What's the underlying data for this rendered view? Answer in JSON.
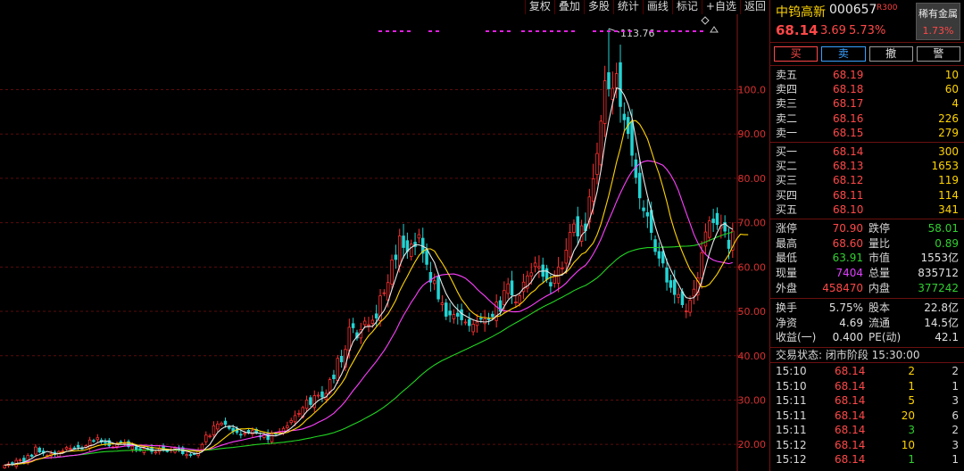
{
  "toolbar": [
    "复权",
    "叠加",
    "多股",
    "统计",
    "画线",
    "标记",
    "+自选",
    "返回"
  ],
  "stock": {
    "name": "中钨高新",
    "code": "000657",
    "badge": "R300",
    "price": "68.14",
    "change": "3.69",
    "change_pct": "5.73%",
    "sector_name": "稀有金属",
    "sector_pct": "1.73%"
  },
  "trade_buttons": [
    "买",
    "卖",
    "撤",
    "警"
  ],
  "order_book": {
    "asks": [
      {
        "label": "卖五",
        "price": "68.19",
        "vol": "10"
      },
      {
        "label": "卖四",
        "price": "68.18",
        "vol": "60"
      },
      {
        "label": "卖三",
        "price": "68.17",
        "vol": "4"
      },
      {
        "label": "卖二",
        "price": "68.16",
        "vol": "226"
      },
      {
        "label": "卖一",
        "price": "68.15",
        "vol": "279"
      }
    ],
    "bids": [
      {
        "label": "买一",
        "price": "68.14",
        "vol": "300"
      },
      {
        "label": "买二",
        "price": "68.13",
        "vol": "1653"
      },
      {
        "label": "买三",
        "price": "68.12",
        "vol": "119"
      },
      {
        "label": "买四",
        "price": "68.11",
        "vol": "114"
      },
      {
        "label": "买五",
        "price": "68.10",
        "vol": "341"
      }
    ]
  },
  "stats_a": [
    {
      "k1": "涨停",
      "v1": "70.90",
      "c1": "red",
      "k2": "跌停",
      "v2": "58.01",
      "c2": "green"
    },
    {
      "k1": "最高",
      "v1": "68.60",
      "c1": "red",
      "k2": "量比",
      "v2": "0.89",
      "c2": "green"
    },
    {
      "k1": "最低",
      "v1": "63.91",
      "c1": "green",
      "k2": "市值",
      "v2": "1553亿",
      "c2": "white"
    },
    {
      "k1": "现量",
      "v1": "7404",
      "c1": "magenta",
      "k2": "总量",
      "v2": "835712",
      "c2": "white"
    },
    {
      "k1": "外盘",
      "v1": "458470",
      "c1": "red",
      "k2": "内盘",
      "v2": "377242",
      "c2": "green"
    }
  ],
  "stats_b": [
    {
      "k1": "换手",
      "v1": "5.75%",
      "c1": "white",
      "k2": "股本",
      "v2": "22.8亿",
      "c2": "white"
    },
    {
      "k1": "净资",
      "v1": "4.69",
      "c1": "white",
      "k2": "流通",
      "v2": "14.5亿",
      "c2": "white"
    },
    {
      "k1": "收益(一)",
      "v1": "0.400",
      "c1": "white",
      "k2": "PE(动)",
      "v2": "42.1",
      "c2": "white"
    }
  ],
  "trade_status": "交易状态: 闭市阶段 15:30:00",
  "ticks": [
    {
      "time": "15:10",
      "price": "68.14",
      "vol": "2",
      "vc": "yellow",
      "num": "2"
    },
    {
      "time": "15:10",
      "price": "68.14",
      "vol": "1",
      "vc": "yellow",
      "num": "1"
    },
    {
      "time": "15:11",
      "price": "68.14",
      "vol": "5",
      "vc": "yellow",
      "num": "3"
    },
    {
      "time": "15:11",
      "price": "68.14",
      "vol": "20",
      "vc": "yellow",
      "num": "6"
    },
    {
      "time": "15:11",
      "price": "68.14",
      "vol": "3",
      "vc": "green",
      "num": "2"
    },
    {
      "time": "15:12",
      "price": "68.14",
      "vol": "10",
      "vc": "yellow",
      "num": "3"
    },
    {
      "time": "15:12",
      "price": "68.14",
      "vol": "1",
      "vc": "green",
      "num": "1"
    }
  ],
  "chart_data": {
    "type": "candlestick",
    "ylim": [
      14,
      117
    ],
    "y_ticks": [
      20,
      30,
      40,
      50,
      60,
      70,
      80,
      90,
      100
    ],
    "y_tick_labels": [
      "20.00",
      "30.00",
      "40.00",
      "50.00",
      "60.00",
      "70.00",
      "80.00",
      "90.00",
      "100.0"
    ],
    "peak_label": "113.76",
    "colors": {
      "up": "#ff3030",
      "down": "#22d4d4",
      "ma5": "#e8e8e8",
      "ma10": "#ffd400",
      "ma20": "#ff40ff",
      "ma60": "#22d422"
    },
    "close": [
      15.3,
      15.6,
      15.4,
      16.4,
      16.5,
      16.1,
      17.5,
      17.3,
      19.4,
      18.3,
      18.0,
      17.5,
      17.9,
      17.7,
      18.4,
      18.5,
      19.3,
      19.1,
      19.2,
      19.4,
      19.1,
      19.7,
      21.0,
      20.7,
      21.5,
      20.5,
      20.4,
      19.7,
      19.4,
      20.0,
      20.5,
      20.4,
      19.5,
      19.6,
      18.7,
      18.6,
      19.1,
      18.9,
      18.4,
      18.3,
      19.1,
      18.8,
      18.4,
      18.8,
      19.2,
      18.9,
      17.9,
      17.7,
      17.5,
      17.8,
      18.7,
      20.0,
      22.1,
      21.9,
      24.2,
      24.6,
      24.8,
      24.5,
      23.6,
      23.0,
      22.7,
      22.2,
      22.5,
      22.6,
      23.1,
      22.6,
      21.7,
      22.1,
      21.1,
      22.5,
      22.3,
      22.9,
      23.6,
      24.2,
      25.4,
      26.5,
      27.0,
      28.3,
      30.0,
      29.0,
      31.0,
      31.1,
      30.7,
      31.5,
      34.6,
      34.8,
      39.4,
      38.6,
      41.4,
      46.4,
      46.3,
      44.0,
      45.9,
      47.8,
      47.0,
      48.0,
      48.5,
      53.5,
      54.2,
      56.5,
      61.6,
      61.7,
      67.0,
      64.4,
      63.5,
      65.2,
      64.6,
      67.3,
      63.1,
      60.6,
      56.6,
      56.9,
      52.8,
      51.9,
      48.9,
      49.2,
      49.3,
      48.9,
      48.1,
      47.6,
      46.8,
      47.1,
      47.6,
      48.4,
      48.3,
      48.2,
      48.8,
      52.1,
      50.0,
      54.7,
      56.2,
      53.7,
      52.1,
      53.5,
      56.6,
      58.0,
      58.7,
      60.9,
      60.1,
      57.9,
      57.2,
      55.7,
      58.1,
      60.0,
      59.8,
      63.8,
      67.8,
      69.7,
      67.0,
      69.3,
      68.2,
      75.8,
      79.9,
      85.6,
      92.9,
      102.0,
      100.2,
      100.3,
      103.6,
      96.2,
      93.2,
      90.1,
      85.2,
      80.2,
      75.6,
      72.7,
      71.5,
      67.8,
      63.5,
      62.0,
      60.9,
      56.6,
      55.4,
      53.8,
      53.8,
      51.5,
      50.1,
      52.5,
      55.0,
      57.5,
      63.2,
      67.9,
      70.4,
      70.0,
      69.6,
      69.2,
      68.1,
      64.2,
      68.1
    ],
    "ma5": [
      15.3,
      15.5,
      15.4,
      15.7,
      15.8,
      16.0,
      16.4,
      16.8,
      17.4,
      17.7,
      18.1,
      18.4,
      18.2,
      17.9,
      17.9,
      18.0,
      18.4,
      18.6,
      18.9,
      19.1,
      19.2,
      19.3,
      19.7,
      19.9,
      20.4,
      20.7,
      20.8,
      20.6,
      20.3,
      20.0,
      20.0,
      20.0,
      20.0,
      20.0,
      19.7,
      19.4,
      19.3,
      19.0,
      18.7,
      18.7,
      18.7,
      18.7,
      18.7,
      18.7,
      18.9,
      18.8,
      18.6,
      18.5,
      18.2,
      18.0,
      17.9,
      18.3,
      19.2,
      20.0,
      21.4,
      22.7,
      23.5,
      24.0,
      24.1,
      24.1,
      23.7,
      23.2,
      22.8,
      22.6,
      22.6,
      22.6,
      22.5,
      22.4,
      21.9,
      22.0,
      21.9,
      22.2,
      22.5,
      23.1,
      23.7,
      24.5,
      25.3,
      26.3,
      27.4,
      28.2,
      29.1,
      29.9,
      30.4,
      30.7,
      31.8,
      32.5,
      34.2,
      35.8,
      37.8,
      41.0,
      43.2,
      44.3,
      45.2,
      46.5,
      46.6,
      46.6,
      47.6,
      49.0,
      50.2,
      52.1,
      54.9,
      57.5,
      60.2,
      62.3,
      63.6,
      64.4,
      65.0,
      65.0,
      64.7,
      64.2,
      62.5,
      61.0,
      58.4,
      56.1,
      54.0,
      52.5,
      51.3,
      50.4,
      49.5,
      49.0,
      48.5,
      48.1,
      47.8,
      47.7,
      47.6,
      47.7,
      48.1,
      49.0,
      49.6,
      51.1,
      52.5,
      53.4,
      53.6,
      54.1,
      55.2,
      55.7,
      56.6,
      58.1,
      59.0,
      59.1,
      59.1,
      58.5,
      58.1,
      58.1,
      58.2,
      59.1,
      61.2,
      63.6,
      65.1,
      67.2,
      68.1,
      70.6,
      73.3,
      77.0,
      81.9,
      87.9,
      92.9,
      96.9,
      100.4,
      100.1,
      98.8,
      96.7,
      93.7,
      89.0,
      84.3,
      79.9,
      76.0,
      72.8,
      69.2,
      66.5,
      64.1,
      61.3,
      59.4,
      57.6,
      56.1,
      54.4,
      53.1,
      52.9,
      53.1,
      54.3,
      56.7,
      60.0,
      63.1,
      65.7,
      67.8,
      69.4,
      69.8,
      69.0,
      68.5
    ],
    "ma10": [
      15.3,
      15.4,
      15.4,
      15.5,
      15.6,
      15.7,
      15.9,
      16.1,
      16.5,
      16.7,
      17.0,
      17.3,
      17.6,
      17.8,
      18.0,
      18.2,
      18.4,
      18.5,
      18.5,
      18.6,
      18.6,
      18.8,
      19.1,
      19.4,
      19.7,
      19.9,
      20.0,
      20.1,
      20.1,
      20.2,
      20.3,
      20.4,
      20.4,
      20.2,
      19.9,
      19.7,
      19.6,
      19.5,
      19.3,
      19.2,
      19.1,
      19.0,
      18.9,
      18.8,
      18.8,
      18.8,
      18.7,
      18.6,
      18.5,
      18.5,
      18.4,
      18.5,
      18.8,
      19.1,
      19.6,
      20.2,
      20.9,
      21.6,
      22.3,
      22.9,
      23.3,
      23.5,
      23.5,
      23.6,
      23.5,
      23.3,
      23.0,
      22.8,
      22.6,
      22.5,
      22.5,
      22.5,
      22.6,
      22.7,
      23.1,
      23.5,
      24.0,
      24.7,
      25.6,
      26.3,
      27.1,
      27.9,
      28.8,
      29.6,
      30.5,
      31.4,
      32.6,
      33.7,
      35.1,
      37.1,
      38.6,
      40.2,
      41.7,
      43.3,
      44.5,
      45.4,
      46.5,
      47.6,
      48.4,
      49.4,
      50.9,
      52.5,
      54.6,
      56.3,
      57.9,
      59.6,
      61.2,
      62.6,
      63.5,
      64.1,
      64.1,
      63.6,
      62.2,
      60.9,
      59.4,
      57.8,
      56.1,
      54.3,
      52.7,
      51.6,
      50.4,
      49.6,
      49.0,
      48.7,
      48.6,
      48.5,
      48.4,
      48.8,
      49.0,
      49.6,
      50.1,
      50.6,
      51.0,
      51.5,
      52.3,
      53.3,
      54.2,
      54.8,
      55.8,
      56.4,
      57.2,
      57.7,
      57.9,
      58.0,
      58.4,
      58.8,
      59.7,
      61.0,
      61.9,
      62.9,
      63.3,
      64.4,
      65.4,
      67.3,
      69.7,
      72.9,
      76.1,
      79.7,
      83.6,
      86.8,
      90.6,
      92.0,
      93.0,
      93.0,
      92.2,
      90.7,
      88.9,
      86.2,
      83.4,
      81.0,
      78.0,
      74.7,
      71.1,
      68.1,
      65.6,
      63.4,
      61.3,
      59.4,
      58.2,
      56.8,
      55.5,
      55.6,
      56.1,
      57.2,
      58.4,
      59.9,
      61.5,
      62.8,
      64.6,
      66.3,
      67.4,
      67.3,
      67.3
    ]
  }
}
